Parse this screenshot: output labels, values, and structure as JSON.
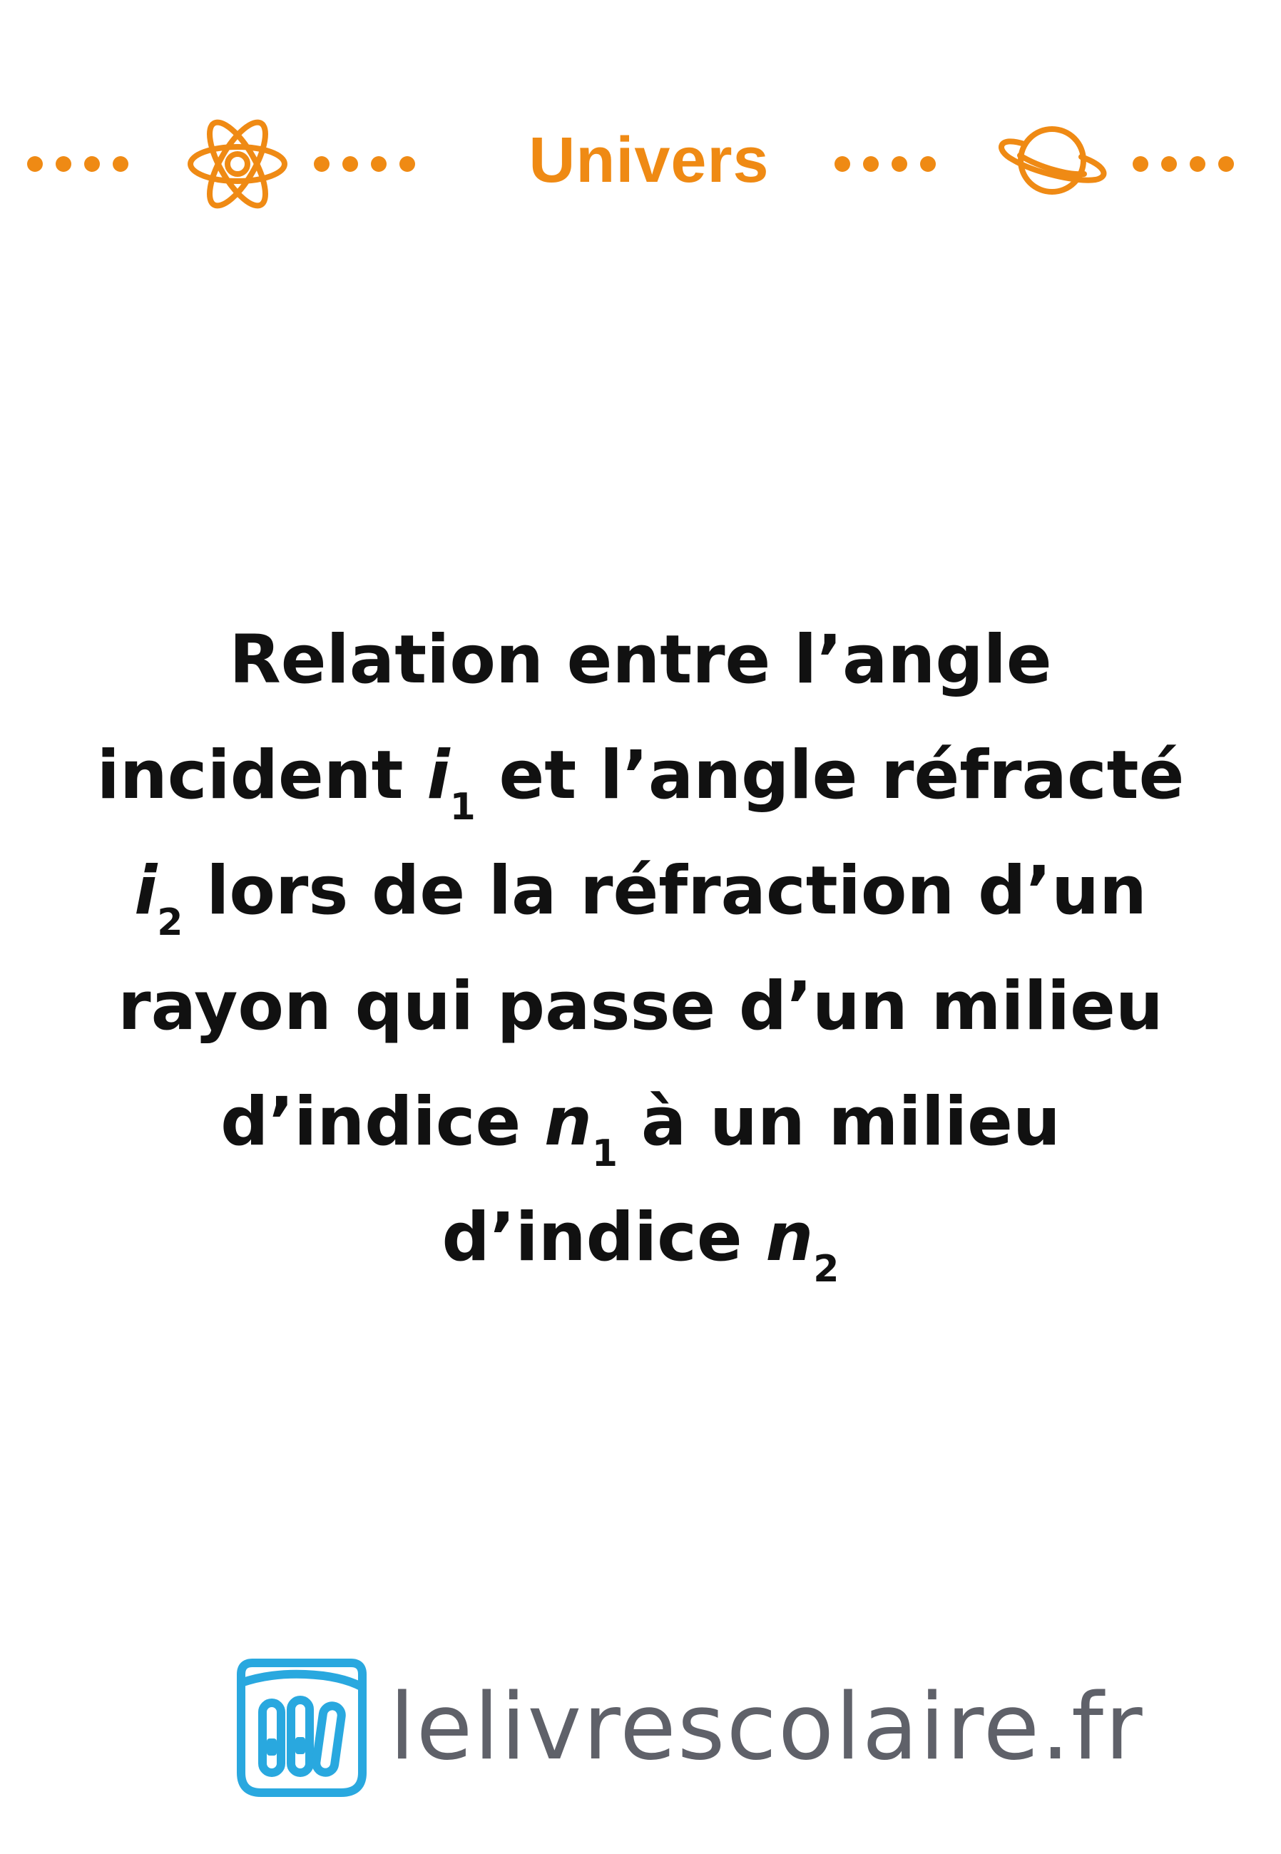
{
  "header": {
    "category": "Univers",
    "left_icon": "atom-icon",
    "right_icon": "planet-icon",
    "accent_color": "#ef8a14"
  },
  "card": {
    "seg1": "Relation entre l’angle incident ",
    "var_i": "i",
    "sub_1": "1",
    "seg2": " et l’angle réfracté ",
    "sub_2": "2",
    "seg3": " lors de la réfraction d’un rayon qui passe d’un milieu d’indice ",
    "var_n": "n",
    "seg4": " à un milieu d’indice "
  },
  "footer": {
    "logo_icon": "books-logo-icon",
    "brand": "lelivrescolaire.fr",
    "logo_color": "#29a8df",
    "brand_color": "#5f6169"
  }
}
